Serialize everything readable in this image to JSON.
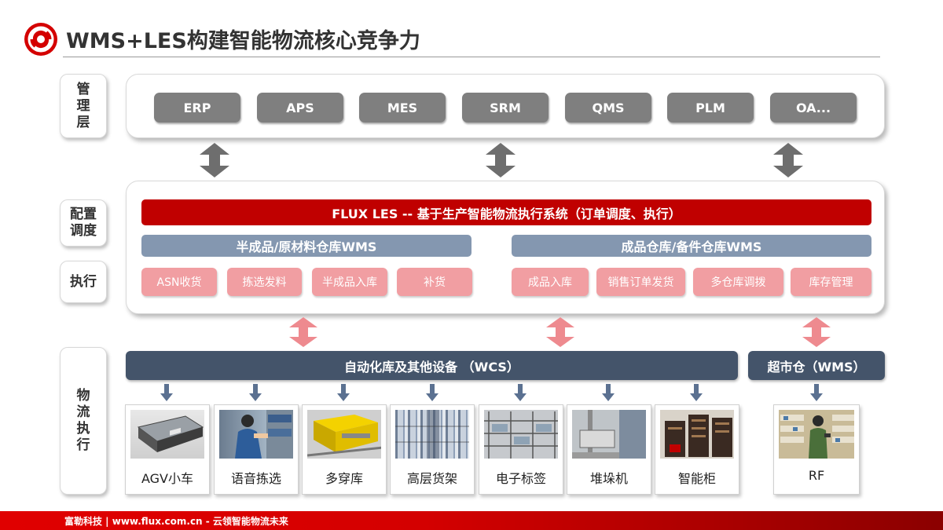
{
  "header": {
    "title": "WMS+LES构建智能物流核心竞争力"
  },
  "layers": {
    "management": "管理层",
    "config": "配置调度",
    "execute": "执行",
    "logistics": "物流执行"
  },
  "systems": [
    "ERP",
    "APS",
    "MES",
    "SRM",
    "QMS",
    "PLM",
    "OA..."
  ],
  "les_bar": "FLUX LES -- 基于生产智能物流执行系统（订单调度、执行）",
  "wms_left": {
    "title": "半成品/原材料仓库WMS",
    "items": [
      "ASN收货",
      "拣选发料",
      "半成品入库",
      "补货"
    ]
  },
  "wms_right": {
    "title": "成品仓库/备件仓库WMS",
    "items": [
      "成品入库",
      "销售订单发货",
      "多仓库调拨",
      "库存管理"
    ]
  },
  "wcs_bar": "自动化库及其他设备 （WCS）",
  "supermarket_bar": "超市仓（WMS）",
  "devices": [
    "AGV小车",
    "语音拣选",
    "多穿库",
    "高层货架",
    "电子标签",
    "堆垛机",
    "智能柜"
  ],
  "rf_device": "RF",
  "footer": {
    "text": "富勒科技 | www.flux.com.cn  -  云领智能物流未来"
  },
  "colors": {
    "brand_red": "#c00000",
    "wms_blue": "#8497b0",
    "pink": "#f19ea2",
    "wcs_dark": "#44546a",
    "system_gray": "#7f7f7f"
  }
}
